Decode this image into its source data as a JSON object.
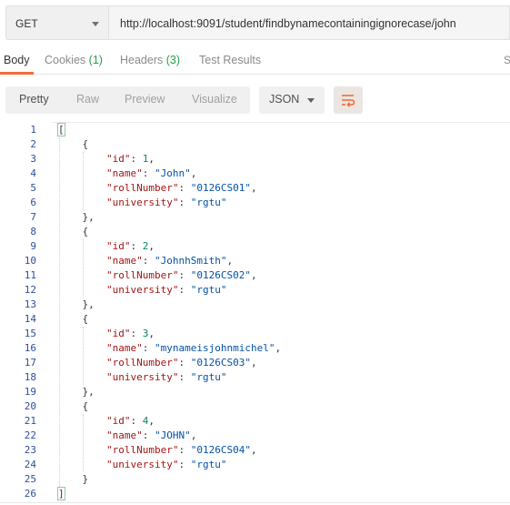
{
  "request": {
    "method": "GET",
    "url": "http://localhost:9091/student/findbynamecontainingignorecase/john"
  },
  "response_tabs": {
    "body": "Body",
    "cookies": "Cookies",
    "cookies_count": "(1)",
    "headers": "Headers",
    "headers_count": "(3)",
    "test_results": "Test Results",
    "edge_text": "S"
  },
  "toolbar": {
    "pretty": "Pretty",
    "raw": "Raw",
    "preview": "Preview",
    "visualize": "Visualize",
    "format": "JSON",
    "wrap_icon": "wrap-lines-icon"
  },
  "colors": {
    "accent": "#f26b3a",
    "count_green": "#24a148",
    "line_numbers": "#2e4f9c",
    "json_key": "#a31515",
    "json_string": "#0451a5",
    "json_number": "#098658"
  },
  "response_body": [
    {
      "id": 1,
      "name": "John",
      "rollNumber": "0126CS01",
      "university": "rgtu"
    },
    {
      "id": 2,
      "name": "JohnhSmith",
      "rollNumber": "0126CS02",
      "university": "rgtu"
    },
    {
      "id": 3,
      "name": "mynameisjohnmichel",
      "rollNumber": "0126CS03",
      "university": "rgtu"
    },
    {
      "id": 4,
      "name": "JOHN",
      "rollNumber": "0126CS04",
      "university": "rgtu"
    }
  ]
}
